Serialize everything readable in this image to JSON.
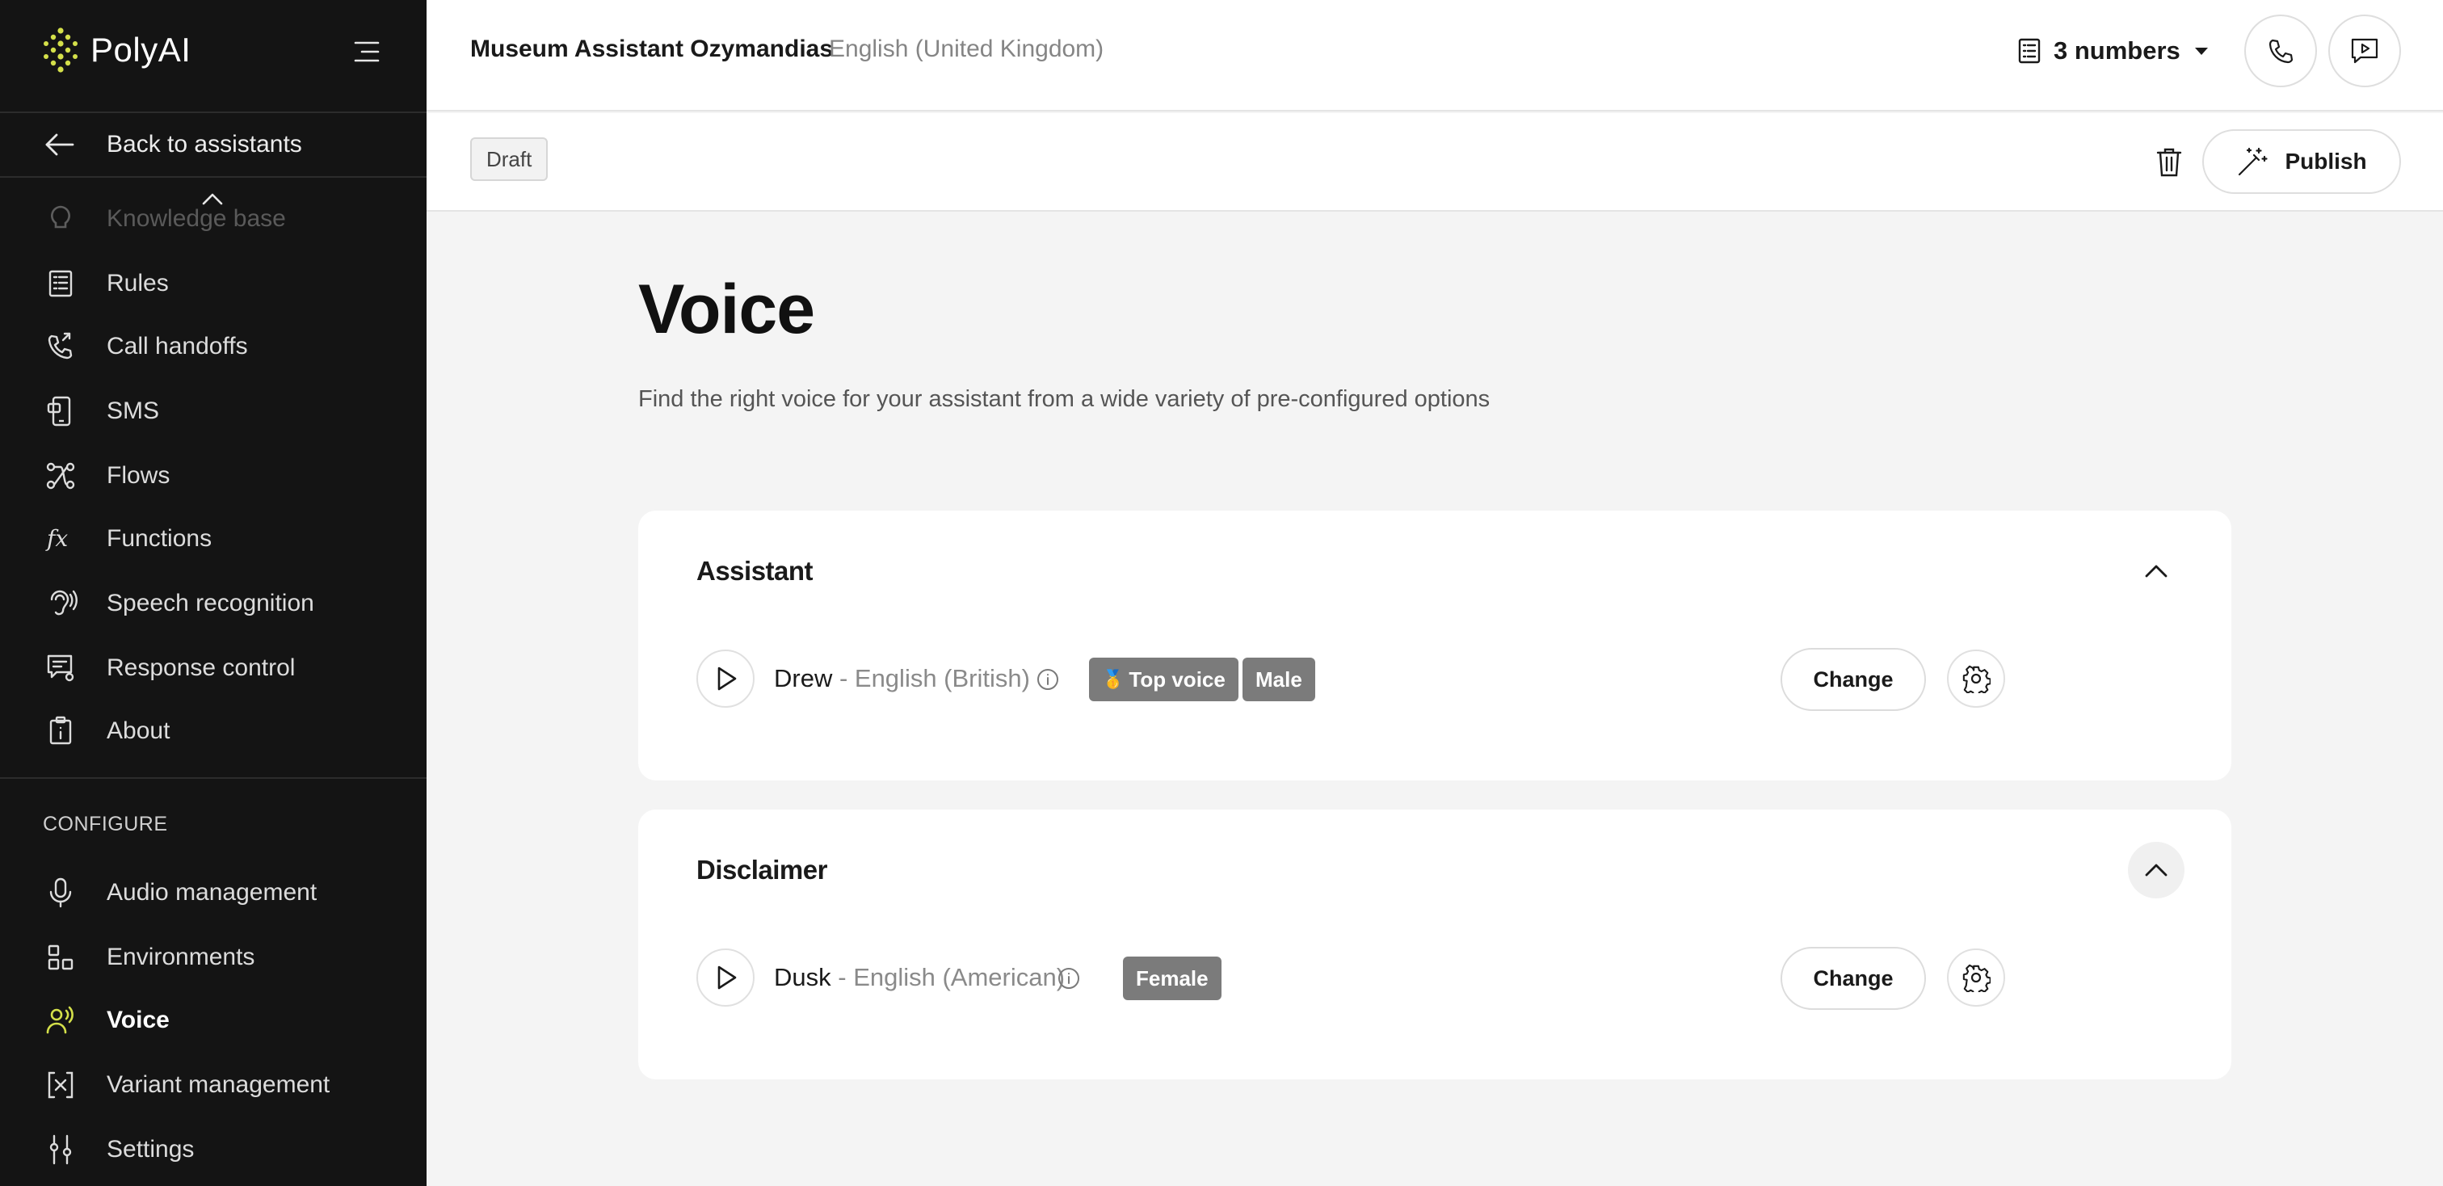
{
  "brand": {
    "name": "PolyAI",
    "accent": "#d4e04a"
  },
  "sidebar": {
    "back_label": "Back to assistants",
    "items_top": [
      {
        "label": "Knowledge base",
        "icon": "lightbulb-icon",
        "state": "faded"
      },
      {
        "label": "Rules",
        "icon": "rules-icon"
      },
      {
        "label": "Call handoffs",
        "icon": "phone-forward-icon"
      },
      {
        "label": "SMS",
        "icon": "sms-icon"
      },
      {
        "label": "Flows",
        "icon": "flows-icon"
      },
      {
        "label": "Functions",
        "icon": "function-icon"
      },
      {
        "label": "Speech recognition",
        "icon": "ear-icon"
      },
      {
        "label": "Response control",
        "icon": "response-control-icon"
      },
      {
        "label": "About",
        "icon": "about-icon"
      }
    ],
    "configure_heading": "CONFIGURE",
    "items_configure": [
      {
        "label": "Audio management",
        "icon": "microphone-icon"
      },
      {
        "label": "Environments",
        "icon": "environments-icon"
      },
      {
        "label": "Voice",
        "icon": "voice-icon",
        "state": "active"
      },
      {
        "label": "Variant management",
        "icon": "variant-icon"
      },
      {
        "label": "Settings",
        "icon": "sliders-icon"
      }
    ]
  },
  "header": {
    "assistant_name": "Museum Assistant Ozymandias",
    "assistant_language": "English (United Kingdom)",
    "numbers_label": "3 numbers"
  },
  "actionbar": {
    "status": "Draft",
    "publish_label": "Publish"
  },
  "page": {
    "title": "Voice",
    "subtitle": "Find the right voice for your assistant from a wide variety of pre-configured options"
  },
  "cards": [
    {
      "title": "Assistant",
      "voice_name": "Drew",
      "voice_lang": " - English (British)",
      "tags": [
        "Top voice",
        "Male"
      ],
      "change_label": "Change"
    },
    {
      "title": "Disclaimer",
      "voice_name": "Dusk",
      "voice_lang": " - English (American)",
      "tags": [
        "Female"
      ],
      "change_label": "Change"
    }
  ]
}
